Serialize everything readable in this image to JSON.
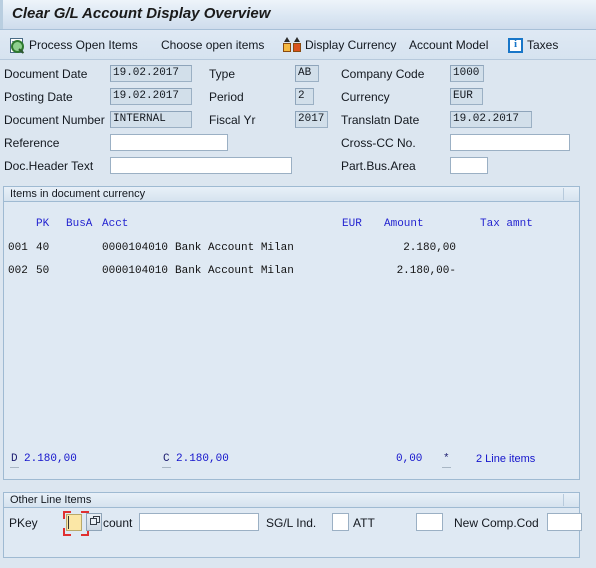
{
  "window": {
    "title": "Clear G/L Account Display Overview"
  },
  "toolbar": {
    "items": [
      {
        "label": "Process Open Items",
        "icon": "magnifier-document-icon"
      },
      {
        "label": "Choose open items",
        "icon": ""
      },
      {
        "label": "Display Currency",
        "icon": "currency-arrows-icon"
      },
      {
        "label": "Account Model",
        "icon": ""
      },
      {
        "label": "Taxes",
        "icon": "info-icon"
      }
    ]
  },
  "header_form": {
    "col1": [
      {
        "label": "Document Date",
        "value": "19.02.2017",
        "readonly": true
      },
      {
        "label": "Posting Date",
        "value": "19.02.2017",
        "readonly": true
      },
      {
        "label": "Document Number",
        "value": "INTERNAL",
        "readonly": true
      },
      {
        "label": "Reference",
        "value": "",
        "readonly": false
      },
      {
        "label": "Doc.Header Text",
        "value": "",
        "readonly": false
      }
    ],
    "col2": [
      {
        "label": "Type",
        "value": "AB",
        "readonly": true
      },
      {
        "label": "Period",
        "value": "2",
        "readonly": true
      },
      {
        "label": "Fiscal Yr",
        "value": "2017",
        "readonly": true
      }
    ],
    "col3": [
      {
        "label": "Company Code",
        "value": "1000",
        "readonly": true
      },
      {
        "label": "Currency",
        "value": "EUR",
        "readonly": true
      },
      {
        "label": "Translatn Date",
        "value": "19.02.2017",
        "readonly": true
      },
      {
        "label": "Cross-CC No.",
        "value": "",
        "readonly": false
      },
      {
        "label": "Part.Bus.Area",
        "value": "",
        "readonly": false
      }
    ]
  },
  "items_panel": {
    "title": "Items in document currency",
    "columns": [
      "PK",
      "BusA",
      "Acct",
      "EUR",
      "Amount",
      "Tax amnt"
    ],
    "rows": [
      {
        "item": "001",
        "pk": "40",
        "busa": "",
        "acct": "0000104010",
        "text": "Bank Account Milan",
        "amount": "2.180,00",
        "tax": ""
      },
      {
        "item": "002",
        "pk": "50",
        "busa": "",
        "acct": "0000104010",
        "text": "Bank Account Milan",
        "amount": "2.180,00-",
        "tax": ""
      }
    ],
    "totals": {
      "debit_key": "D",
      "debit_value": "2.180,00",
      "credit_key": "C",
      "credit_value": "2.180,00",
      "tax_total": "0,00",
      "star": "*",
      "line_items": "2 Line items"
    }
  },
  "other_line_items": {
    "title": "Other Line Items",
    "pkey_label": "PKey",
    "pkey_value": "",
    "account_label": "count",
    "account_value": "",
    "sgl_label": "SG/L Ind.",
    "sgl_value": "",
    "att_label": "ATT",
    "att_value": "",
    "new_comp_code_label": "New Comp.Cod",
    "new_comp_code_value": ""
  },
  "colors": {
    "background": "#dce6f0",
    "panel_bg": "#dfe9f3",
    "accent_blue": "#1414cc",
    "focus_red": "#e03030",
    "focus_yellow": "#fbe7a6"
  }
}
